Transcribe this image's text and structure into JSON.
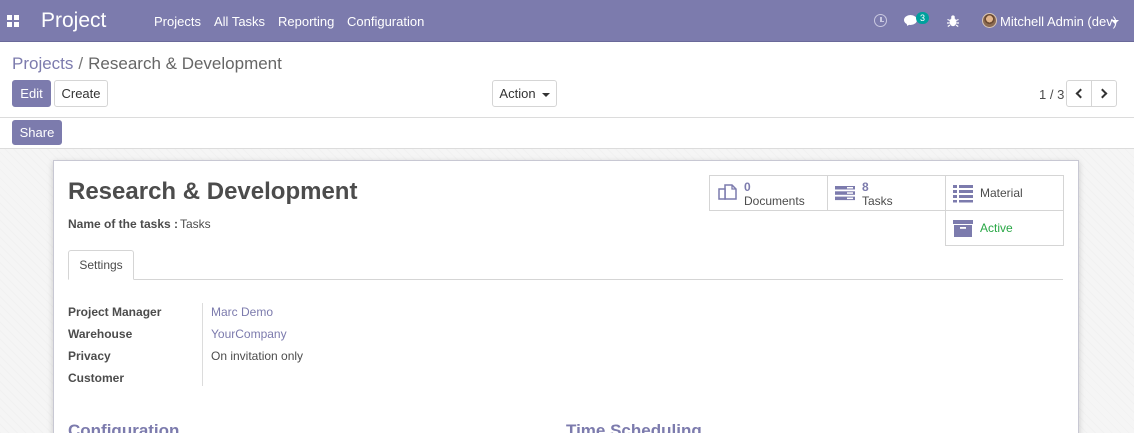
{
  "navbar": {
    "brand": "Project",
    "menu": [
      "Projects",
      "All Tasks",
      "Reporting",
      "Configuration"
    ],
    "chat_count": "3",
    "user_name": "Mitchell Admin (dev)"
  },
  "breadcrumb": {
    "parent": "Projects",
    "separator": "/",
    "current": "Research & Development"
  },
  "toolbar": {
    "edit_label": "Edit",
    "create_label": "Create",
    "action_label": "Action",
    "pager_value": "1 / 3"
  },
  "statusbar": {
    "share_label": "Share"
  },
  "record": {
    "title": "Research & Development",
    "task_name_label": "Name of the tasks :",
    "task_name_value": "Tasks"
  },
  "smart_buttons": {
    "documents": {
      "count": "0",
      "label": "Documents",
      "icon": "documents-icon"
    },
    "tasks": {
      "count": "8",
      "label": "Tasks",
      "icon": "tasks-icon"
    },
    "material": {
      "label": "Material",
      "icon": "list-icon"
    },
    "active": {
      "label": "Active",
      "icon": "archive-icon"
    }
  },
  "notebook": {
    "tab_label": "Settings",
    "fields": [
      {
        "label": "Project Manager",
        "value": "Marc Demo"
      },
      {
        "label": "Warehouse",
        "value": "YourCompany"
      },
      {
        "label": "Privacy",
        "value": "On invitation only"
      },
      {
        "label": "Customer",
        "value": ""
      }
    ],
    "group_left": "Configuration",
    "group_right": "Time Scheduling"
  },
  "colors": {
    "brand": "#7c7bad",
    "badge": "#00a09d",
    "active": "#28a745"
  }
}
